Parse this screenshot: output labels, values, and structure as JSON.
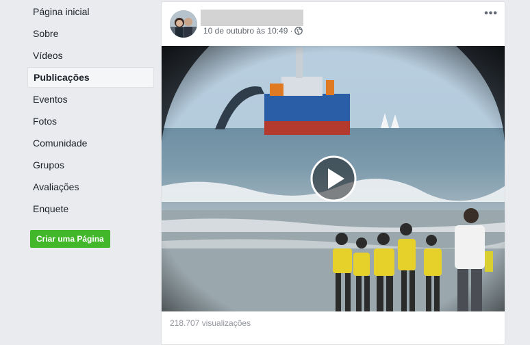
{
  "sidebar": {
    "items": [
      {
        "label": "Página inicial"
      },
      {
        "label": "Sobre"
      },
      {
        "label": "Vídeos"
      },
      {
        "label": "Publicações",
        "active": true
      },
      {
        "label": "Eventos"
      },
      {
        "label": "Fotos"
      },
      {
        "label": "Comunidade"
      },
      {
        "label": "Grupos"
      },
      {
        "label": "Avaliações"
      },
      {
        "label": "Enquete"
      }
    ],
    "create_page_label": "Criar uma Página"
  },
  "post": {
    "timestamp": "10 de outubro às 10:49",
    "separator": "·",
    "audience_icon": "globe-icon",
    "more_icon": "more-options-icon",
    "more_label": "•••",
    "video": {
      "play_icon": "play-icon",
      "views": "218.707 visualizações"
    }
  },
  "colors": {
    "accent_green": "#42b72a",
    "background": "#e9ebee",
    "text": "#1d2129",
    "meta_text": "#616770"
  }
}
